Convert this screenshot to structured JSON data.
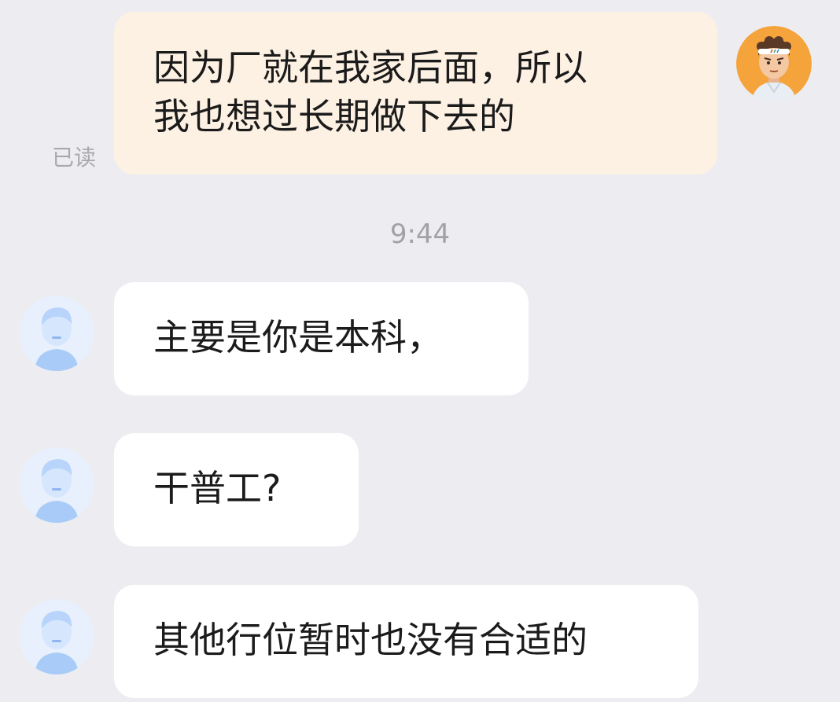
{
  "messages": [
    {
      "sender": "me",
      "lines": [
        "因为厂就在我家后面，所以",
        "我也想过长期做下去的"
      ],
      "status": "已读"
    },
    {
      "sender": "other",
      "text": "主要是你是本科，"
    },
    {
      "sender": "other",
      "text": "干普工?"
    },
    {
      "sender": "other",
      "text": "其他行位暂时也没有合适的"
    }
  ],
  "divider": {
    "time": "9:44"
  },
  "colors": {
    "background": "#ededf1",
    "outgoing_bubble": "#fdf1e3",
    "incoming_bubble": "#ffffff",
    "my_avatar_bg": "#f5a43c",
    "default_avatar": "#bcd8fb"
  },
  "icons": {
    "my_avatar": "cartoon-man-headband-avatar",
    "contact_avatar": "default-person-avatar"
  }
}
